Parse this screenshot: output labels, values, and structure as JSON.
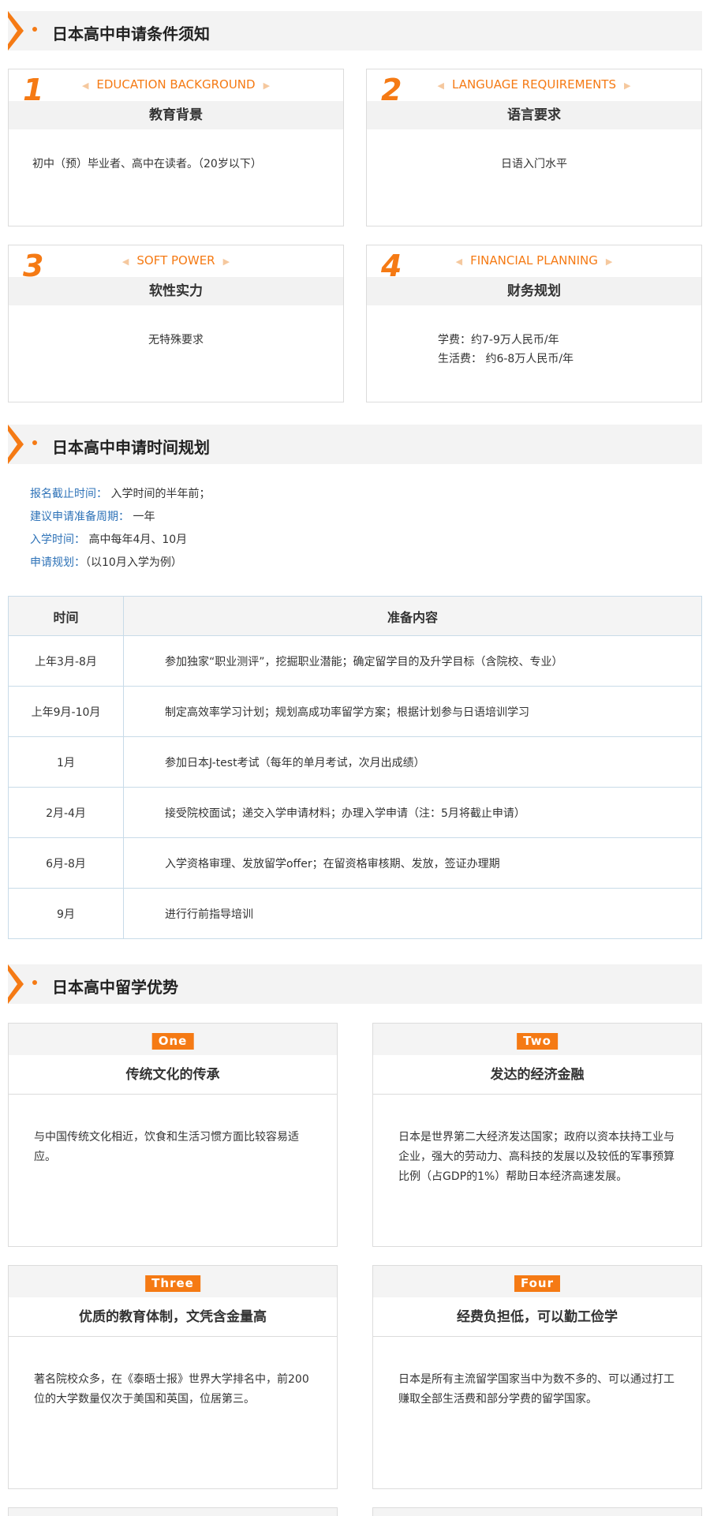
{
  "section1": {
    "title": "日本高中申请条件须知",
    "cards": [
      {
        "num": "1",
        "en": "EDUCATION BACKGROUND",
        "zh": "教育背景",
        "body": "初中（预）毕业者、高中在读者。（20岁以下）"
      },
      {
        "num": "2",
        "en": "LANGUAGE REQUIREMENTS",
        "zh": "语言要求",
        "body": "日语入门水平"
      },
      {
        "num": "3",
        "en": "SOFT POWER",
        "zh": "软性实力",
        "body": "无特殊要求"
      },
      {
        "num": "4",
        "en": "FINANCIAL PLANNING",
        "zh": "财务规划",
        "body_line1": "学费：约7-9万人民币/年",
        "body_line2": "生活费： 约6-8万人民币/年"
      }
    ]
  },
  "section2": {
    "title": "日本高中申请时间规划",
    "info": [
      {
        "key": "报名截止时间：",
        "val": " 入学时间的半年前；"
      },
      {
        "key": "建议申请准备周期：",
        "val": " 一年"
      },
      {
        "key": "入学时间：",
        "val": " 高中每年4月、10月"
      },
      {
        "key": "申请规划：",
        "val": "（以10月入学为例）"
      }
    ],
    "table": {
      "headers": [
        "时间",
        "准备内容"
      ],
      "rows": [
        [
          "上年3月-8月",
          "参加独家“职业测评”，挖掘职业潜能；确定留学目的及升学目标（含院校、专业）"
        ],
        [
          "上年9月-10月",
          "制定高效率学习计划；规划高成功率留学方案；根据计划参与日语培训学习"
        ],
        [
          "1月",
          "参加日本J-test考试（每年的单月考试，次月出成绩）"
        ],
        [
          "2月-4月",
          "接受院校面试；递交入学申请材料；办理入学申请（注：5月将截止申请）"
        ],
        [
          "6月-8月",
          "入学资格审理、发放留学offer；在留资格审核期、发放，签证办理期"
        ],
        [
          "9月",
          "进行行前指导培训"
        ]
      ]
    }
  },
  "section3": {
    "title": "日本高中留学优势",
    "cards": [
      {
        "tag": "One",
        "title": "传统文化的传承",
        "body": "与中国传统文化相近，饮食和生活习惯方面比较容易适应。"
      },
      {
        "tag": "Two",
        "title": "发达的经济金融",
        "body": "日本是世界第二大经济发达国家；政府以资本扶持工业与企业，强大的劳动力、高科技的发展以及较低的军事预算比例（占GDP的1%）帮助日本经济高速发展。"
      },
      {
        "tag": "Three",
        "title": "优质的教育体制，文凭含金量高",
        "body": "著名院校众多，在《泰晤士报》世界大学排名中，前200位的大学数量仅次于美国和英国，位居第三。"
      },
      {
        "tag": "Four",
        "title": "经费负担低，可以勤工俭学",
        "body": "日本是所有主流留学国家当中为数不多的、可以通过打工赚取全部生活费和部分学费的留学国家。"
      }
    ]
  },
  "colors": {
    "accent": "#f57a14",
    "link": "#2f73b8",
    "band": "#f3f3f3"
  }
}
